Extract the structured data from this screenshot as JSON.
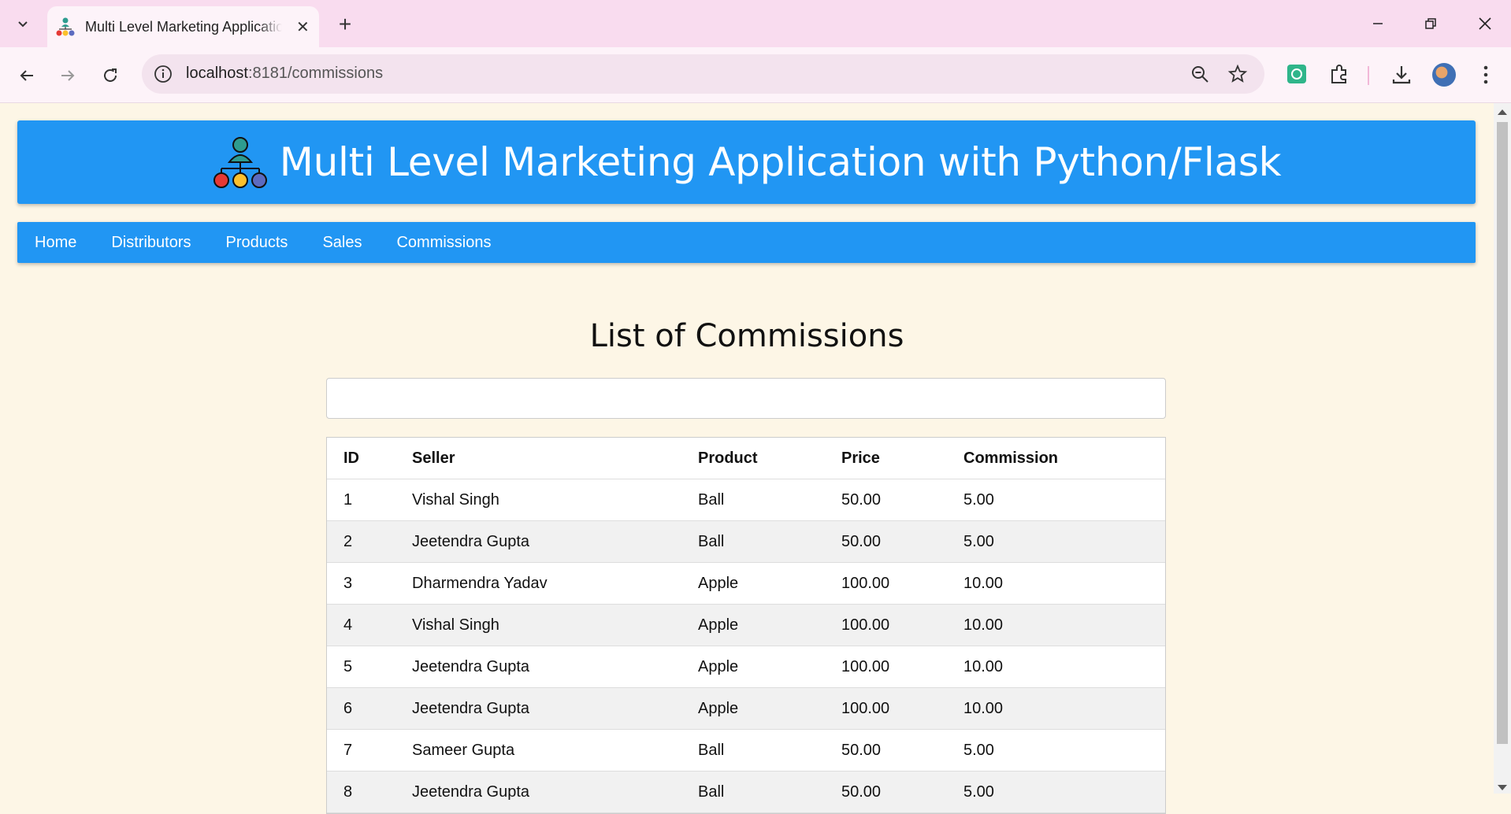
{
  "browser": {
    "tab_title": "Multi Level Marketing Application with Python/Flask",
    "url_host": "localhost",
    "url_path": ":8181/commissions"
  },
  "header": {
    "title": "Multi Level Marketing Application with Python/Flask",
    "logo_icon": "network-people-icon"
  },
  "nav": {
    "items": [
      "Home",
      "Distributors",
      "Products",
      "Sales",
      "Commissions"
    ]
  },
  "page": {
    "title": "List of Commissions",
    "search_value": ""
  },
  "table": {
    "columns": [
      "ID",
      "Seller",
      "Product",
      "Price",
      "Commission"
    ],
    "rows": [
      [
        "1",
        "Vishal Singh",
        "Ball",
        "50.00",
        "5.00"
      ],
      [
        "2",
        "Jeetendra Gupta",
        "Ball",
        "50.00",
        "5.00"
      ],
      [
        "3",
        "Dharmendra Yadav",
        "Apple",
        "100.00",
        "10.00"
      ],
      [
        "4",
        "Vishal Singh",
        "Apple",
        "100.00",
        "10.00"
      ],
      [
        "5",
        "Jeetendra Gupta",
        "Apple",
        "100.00",
        "10.00"
      ],
      [
        "6",
        "Jeetendra Gupta",
        "Apple",
        "100.00",
        "10.00"
      ],
      [
        "7",
        "Sameer Gupta",
        "Ball",
        "50.00",
        "5.00"
      ],
      [
        "8",
        "Jeetendra Gupta",
        "Ball",
        "50.00",
        "5.00"
      ]
    ]
  },
  "colors": {
    "primary": "#2196f3",
    "page_bg": "#fdf6e6",
    "tabbar_bg": "#f9dcef"
  }
}
